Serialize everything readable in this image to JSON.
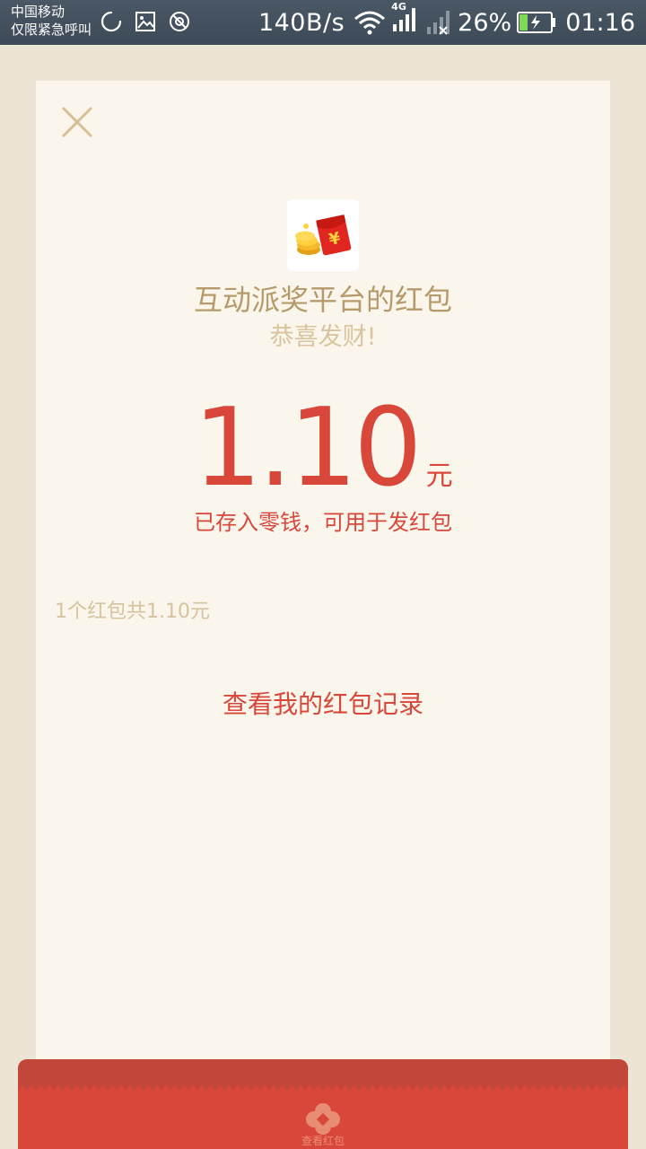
{
  "status_bar": {
    "carrier_line1": "中国移动",
    "carrier_line2": "仅限紧急呼叫",
    "net_speed": "140B/s",
    "network_type": "4G",
    "battery_percent": "26%",
    "time": "01:16"
  },
  "red_packet": {
    "sender_name": "互动派奖平台的红包",
    "wish": "恭喜发财!",
    "amount": "1.10",
    "currency_unit": "元",
    "deposit_note": "已存入零钱，可用于发红包",
    "summary": "1个红包共1.10元",
    "records_link": "查看我的红包记录"
  },
  "footer": {
    "label": "查看红包"
  },
  "colors": {
    "accent_red": "#d9473b",
    "gold_text": "#b79a6b",
    "light_gold_text": "#d9c49f",
    "card_bg": "#faf6ec",
    "page_bg": "#ece4d4"
  },
  "icons": {
    "close": "close-icon",
    "avatar": "red-packet-coins-icon",
    "footer": "flower-logo-icon"
  }
}
